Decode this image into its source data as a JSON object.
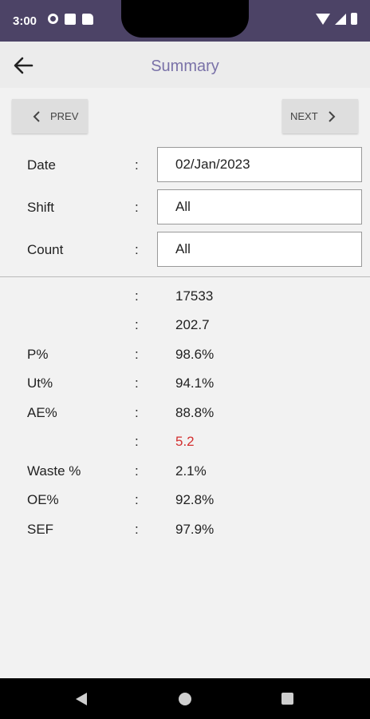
{
  "status_bar": {
    "time": "3:00",
    "left_icons": [
      "gear-icon",
      "box-icon",
      "sd-card-icon"
    ],
    "right_icons": [
      "wifi-icon",
      "signal-icon",
      "battery-icon"
    ]
  },
  "app_bar": {
    "title": "Summary",
    "back_icon": "arrow-left-icon"
  },
  "nav": {
    "prev_label": "PREV",
    "next_label": "NEXT"
  },
  "form": {
    "date": {
      "label": "Date",
      "colon": ":",
      "value": "02/Jan/2023"
    },
    "shift": {
      "label": "Shift",
      "colon": ":",
      "value": "All"
    },
    "count": {
      "label": "Count",
      "colon": ":",
      "value": "All"
    }
  },
  "metrics": [
    {
      "label": "",
      "colon": ":",
      "value": "17533"
    },
    {
      "label": "",
      "colon": ":",
      "value": "202.7"
    },
    {
      "label": "P%",
      "colon": ":",
      "value": "98.6%"
    },
    {
      "label": "Ut%",
      "colon": ":",
      "value": "94.1%"
    },
    {
      "label": "AE%",
      "colon": ":",
      "value": "88.8%"
    },
    {
      "label": "",
      "colon": ":",
      "value": "5.2"
    },
    {
      "label": "Waste %",
      "colon": ":",
      "value": "2.1%"
    },
    {
      "label": "OE%",
      "colon": ":",
      "value": "92.8%"
    },
    {
      "label": "SEF",
      "colon": ":",
      "value": "97.9%"
    }
  ],
  "colors": {
    "status_bar": "#4c4366",
    "title": "#7a72a8",
    "highlight_value": "#d32f2f"
  }
}
